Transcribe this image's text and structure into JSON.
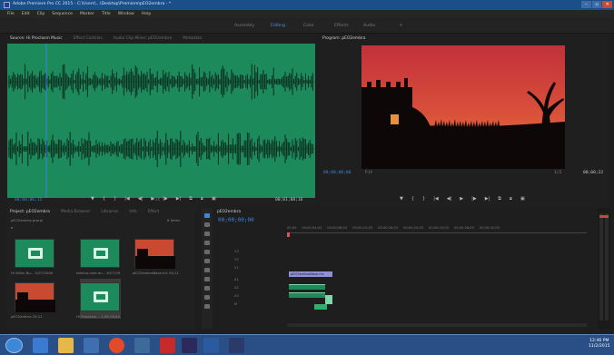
{
  "window": {
    "title": "Adobe Premiere Pro CC 2015 - C:\\Users\\...\\Desktop\\Premiere\\pEO2embra - *",
    "controls": [
      "–",
      "▫",
      "✕"
    ]
  },
  "menu": [
    "File",
    "Edit",
    "Clip",
    "Sequence",
    "Marker",
    "Title",
    "Window",
    "Help"
  ],
  "workspaces": {
    "items": [
      "Assembly",
      "Editing",
      "Color",
      "Effects",
      "Audio"
    ],
    "active": "Editing",
    "more": "»"
  },
  "source": {
    "tabs": [
      "Source: Hi Proclasm Music",
      "Effect Controls",
      "Audio Clip Mixer: pEO2embra",
      "Metadata"
    ],
    "timecode_in": "00;00;06;15",
    "timecode_dur": "00;01;08;16",
    "fit": "Fit"
  },
  "program": {
    "tabs": [
      "Program: pEO2embra"
    ],
    "timecode": "00;00;00;00",
    "fit": "Fit",
    "zoom": "1/2",
    "duration": "00;00;22"
  },
  "transport": [
    "▼",
    "{",
    "}",
    "|◀",
    "◀|",
    "▶",
    "|▶",
    "▶|",
    "⧉",
    "⧈",
    "▣"
  ],
  "project": {
    "tabs": [
      "Project: pEO2embra",
      "Media Browser",
      "Libraries",
      "Info",
      "Effect"
    ],
    "file": "pEO2embra.prproj",
    "count": "6 Items",
    "items": [
      {
        "label": "Hi Wiiliu Bu... 5;07;5006",
        "type": "audio"
      },
      {
        "label": "talking note an... 6;07;09",
        "type": "audio"
      },
      {
        "label": "pEO2embraBase.mc  29;11",
        "type": "video"
      },
      {
        "label": "pEO2embra  29;11",
        "type": "video"
      },
      {
        "label": "Hi Proclasm...  1;08;16;04",
        "type": "audio"
      }
    ]
  },
  "timeline": {
    "tabs": [
      "pEO2embra"
    ],
    "timecode": "00;00;00;00",
    "ruler": [
      "00;00",
      "00;00;04;03",
      "00;00;08;03",
      "00;00;12;03",
      "00;00;16;03",
      "00;00;20;03",
      "00;00;24;03",
      "00;00;28;03",
      "00;00;32;03"
    ],
    "tracks": [
      "V3",
      "V2",
      "V1",
      "A1",
      "A2",
      "A3",
      "M"
    ],
    "clip_label": "pEO2embraBase.mc"
  },
  "taskbar": {
    "time": "12:46 PM",
    "date": "11/2/2015"
  },
  "colors": {
    "title_bar": "#1b4f8a",
    "waveform_bg": "#1d8a5c",
    "accent": "#3c87d6",
    "sky_top": "#c23a2a",
    "sky_bottom": "#e07a35"
  }
}
